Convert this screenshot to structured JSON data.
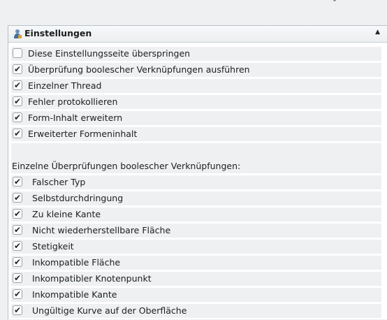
{
  "panel": {
    "title": "Einstellungen",
    "header_icon": "user-settings-icon",
    "collapse_icon": "collapse-up-icon"
  },
  "options": [
    {
      "label": "Diese Einstellungsseite überspringen",
      "checked": false
    },
    {
      "label": "Überprüfung boolescher Verknüpfungen ausführen",
      "checked": true
    },
    {
      "label": "Einzelner Thread",
      "checked": true
    },
    {
      "label": "Fehler protokollieren",
      "checked": true
    },
    {
      "label": "Form-Inhalt erweitern",
      "checked": true
    },
    {
      "label": "Erweiterter Formeninhalt",
      "checked": true
    }
  ],
  "checks_section": {
    "label": "Einzelne Überprüfungen boolescher Verknüpfungen:",
    "items": [
      {
        "label": "Falscher Typ",
        "checked": true
      },
      {
        "label": "Selbstdurchdringung",
        "checked": true
      },
      {
        "label": "Zu kleine Kante",
        "checked": true
      },
      {
        "label": "Nicht wiederherstellbare Fläche",
        "checked": true
      },
      {
        "label": "Stetigkeit",
        "checked": true
      },
      {
        "label": "Inkompatible Fläche",
        "checked": true
      },
      {
        "label": "Inkompatibler Knotenpunkt",
        "checked": true
      },
      {
        "label": "Inkompatible Kante",
        "checked": true
      },
      {
        "label": "Ungültige Kurve auf der Oberfläche",
        "checked": true
      }
    ]
  }
}
